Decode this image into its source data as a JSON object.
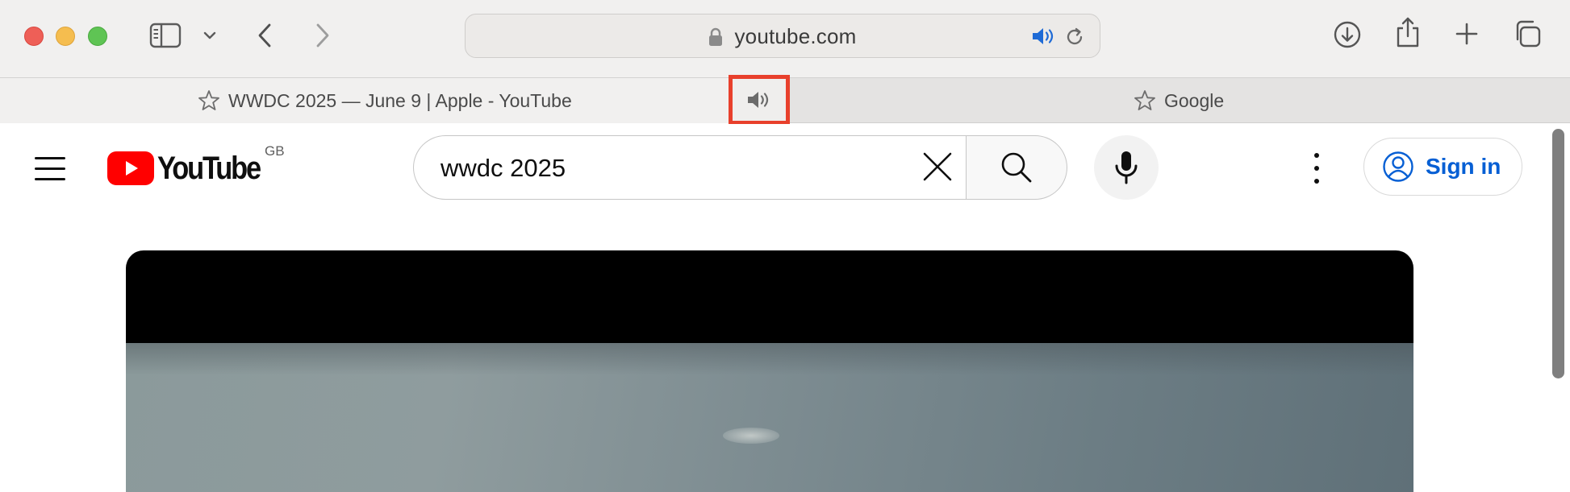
{
  "browser": {
    "url": "youtube.com",
    "tabs": [
      {
        "title": "WWDC 2025 — June 9 | Apple - YouTube",
        "active": true,
        "playing_audio": true
      },
      {
        "title": "Google",
        "active": false
      }
    ],
    "icons": {
      "sidebar": "sidebar-icon",
      "sidebar_menu": "chevron-down-icon",
      "back": "chevron-left-icon",
      "forward": "chevron-right-icon",
      "lock": "lock-icon",
      "audio": "speaker-icon",
      "reload": "reload-icon",
      "downloads": "download-icon",
      "share": "share-icon",
      "new_tab": "plus-icon",
      "tab_overview": "tabs-icon"
    },
    "colors": {
      "audio_highlight": "#e8402c",
      "url_audio": "#1f6bd6"
    }
  },
  "youtube": {
    "logo_text": "YouTube",
    "region": "GB",
    "search": {
      "value": "wwdc 2025",
      "placeholder": "Search"
    },
    "sign_in_label": "Sign in",
    "colors": {
      "brand_red": "#ff0000",
      "sign_in_blue": "#065fd4"
    }
  }
}
